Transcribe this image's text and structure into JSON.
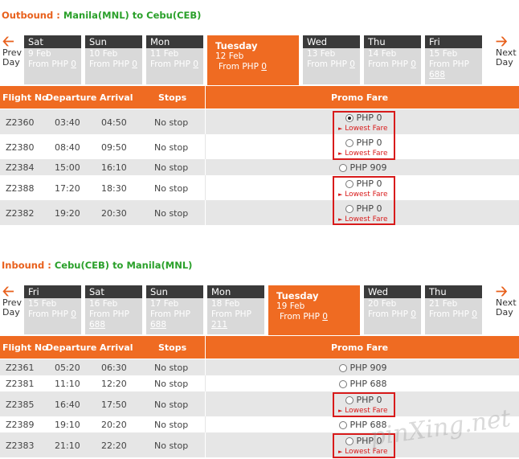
{
  "outbound": {
    "label": "Outbound :",
    "route": "Manila(MNL) to Cebu(CEB)",
    "prev": [
      "Prev",
      "Day"
    ],
    "next": [
      "Next",
      "Day"
    ],
    "days": [
      {
        "name": "Sat",
        "date": "9 Feb",
        "from": "From PHP",
        "amt": "0"
      },
      {
        "name": "Sun",
        "date": "10 Feb",
        "from": "From PHP",
        "amt": "0"
      },
      {
        "name": "Mon",
        "date": "11 Feb",
        "from": "From PHP",
        "amt": "0"
      },
      {
        "name": "Tuesday",
        "date": "12 Feb",
        "from": "From PHP",
        "amt": "0"
      },
      {
        "name": "Wed",
        "date": "13 Feb",
        "from": "From PHP",
        "amt": "0"
      },
      {
        "name": "Thu",
        "date": "14 Feb",
        "from": "From PHP",
        "amt": "0"
      },
      {
        "name": "Fri",
        "date": "15 Feb",
        "from": "From PHP",
        "amt": "688"
      }
    ],
    "headers": [
      "Flight No",
      "Departure",
      "Arrival",
      "Stops",
      "Promo Fare"
    ],
    "flights": [
      {
        "no": "Z2360",
        "dep": "03:40",
        "arr": "04:50",
        "stops": "No stop",
        "fare": "PHP 0",
        "lowest": "Lowest Fare",
        "selected": true
      },
      {
        "no": "Z2380",
        "dep": "08:40",
        "arr": "09:50",
        "stops": "No stop",
        "fare": "PHP 0",
        "lowest": "Lowest Fare",
        "selected": false
      },
      {
        "no": "Z2384",
        "dep": "15:00",
        "arr": "16:10",
        "stops": "No stop",
        "fare": "PHP 909",
        "lowest": "",
        "selected": false
      },
      {
        "no": "Z2388",
        "dep": "17:20",
        "arr": "18:30",
        "stops": "No stop",
        "fare": "PHP 0",
        "lowest": "Lowest Fare",
        "selected": false
      },
      {
        "no": "Z2382",
        "dep": "19:20",
        "arr": "20:30",
        "stops": "No stop",
        "fare": "PHP 0",
        "lowest": "Lowest Fare",
        "selected": false
      }
    ]
  },
  "inbound": {
    "label": "Inbound :",
    "route": "Cebu(CEB) to Manila(MNL)",
    "prev": [
      "Prev",
      "Day"
    ],
    "next": [
      "Next",
      "Day"
    ],
    "days": [
      {
        "name": "Fri",
        "date": "15 Feb",
        "from": "From PHP",
        "amt": "0"
      },
      {
        "name": "Sat",
        "date": "16 Feb",
        "from": "From PHP",
        "amt": "688"
      },
      {
        "name": "Sun",
        "date": "17 Feb",
        "from": "From PHP",
        "amt": "688"
      },
      {
        "name": "Mon",
        "date": "18 Feb",
        "from": "From PHP",
        "amt": "211"
      },
      {
        "name": "Tuesday",
        "date": "19 Feb",
        "from": "From PHP",
        "amt": "0"
      },
      {
        "name": "Wed",
        "date": "20 Feb",
        "from": "From PHP",
        "amt": "0"
      },
      {
        "name": "Thu",
        "date": "21 Feb",
        "from": "From PHP",
        "amt": "0"
      }
    ],
    "headers": [
      "Flight No",
      "Departure",
      "Arrival",
      "Stops",
      "Promo Fare"
    ],
    "flights": [
      {
        "no": "Z2361",
        "dep": "05:20",
        "arr": "06:30",
        "stops": "No stop",
        "fare": "PHP 909",
        "lowest": "",
        "selected": false
      },
      {
        "no": "Z2381",
        "dep": "11:10",
        "arr": "12:20",
        "stops": "No stop",
        "fare": "PHP 688",
        "lowest": "",
        "selected": false
      },
      {
        "no": "Z2385",
        "dep": "16:40",
        "arr": "17:50",
        "stops": "No stop",
        "fare": "PHP 0",
        "lowest": "Lowest Fare",
        "selected": false
      },
      {
        "no": "Z2389",
        "dep": "19:10",
        "arr": "20:20",
        "stops": "No stop",
        "fare": "PHP 688",
        "lowest": "",
        "selected": false
      },
      {
        "no": "Z2383",
        "dep": "21:10",
        "arr": "22:20",
        "stops": "No stop",
        "fare": "PHP 0",
        "lowest": "Lowest Fare",
        "selected": false
      }
    ]
  },
  "watermark": "pinXing.net",
  "colors": {
    "accent": "#ef6b22",
    "route": "#2aa02a",
    "highlight": "#d81b1b",
    "tab_dark": "#3a3a3a"
  }
}
